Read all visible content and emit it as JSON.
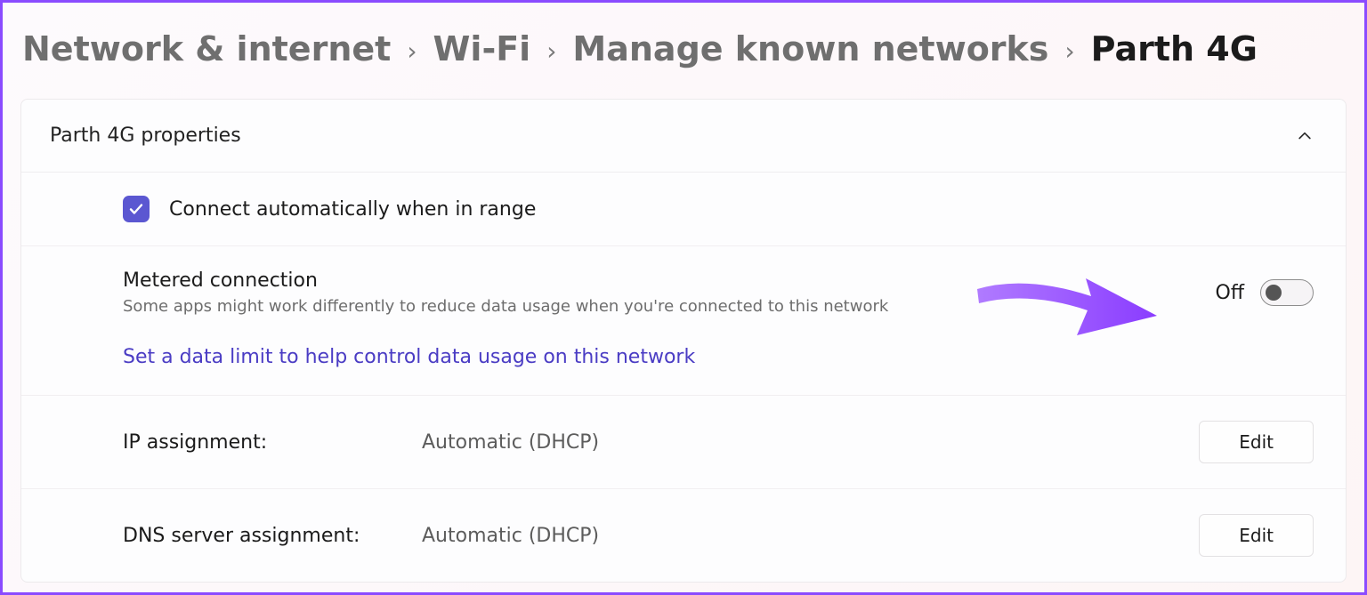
{
  "breadcrumb": {
    "items": [
      {
        "label": "Network & internet"
      },
      {
        "label": "Wi-Fi"
      },
      {
        "label": "Manage known networks"
      },
      {
        "label": "Parth 4G"
      }
    ]
  },
  "panel": {
    "header_title": "Parth 4G properties",
    "connect_auto": {
      "label": "Connect automatically when in range",
      "checked": true
    },
    "metered": {
      "title": "Metered connection",
      "subtitle": "Some apps might work differently to reduce data usage when you're connected to this network",
      "state_label": "Off",
      "on": false
    },
    "data_limit_link": "Set a data limit to help control data usage on this network",
    "ip_assignment": {
      "label": "IP assignment:",
      "value": "Automatic (DHCP)",
      "edit_label": "Edit"
    },
    "dns_assignment": {
      "label": "DNS server assignment:",
      "value": "Automatic (DHCP)",
      "edit_label": "Edit"
    }
  }
}
